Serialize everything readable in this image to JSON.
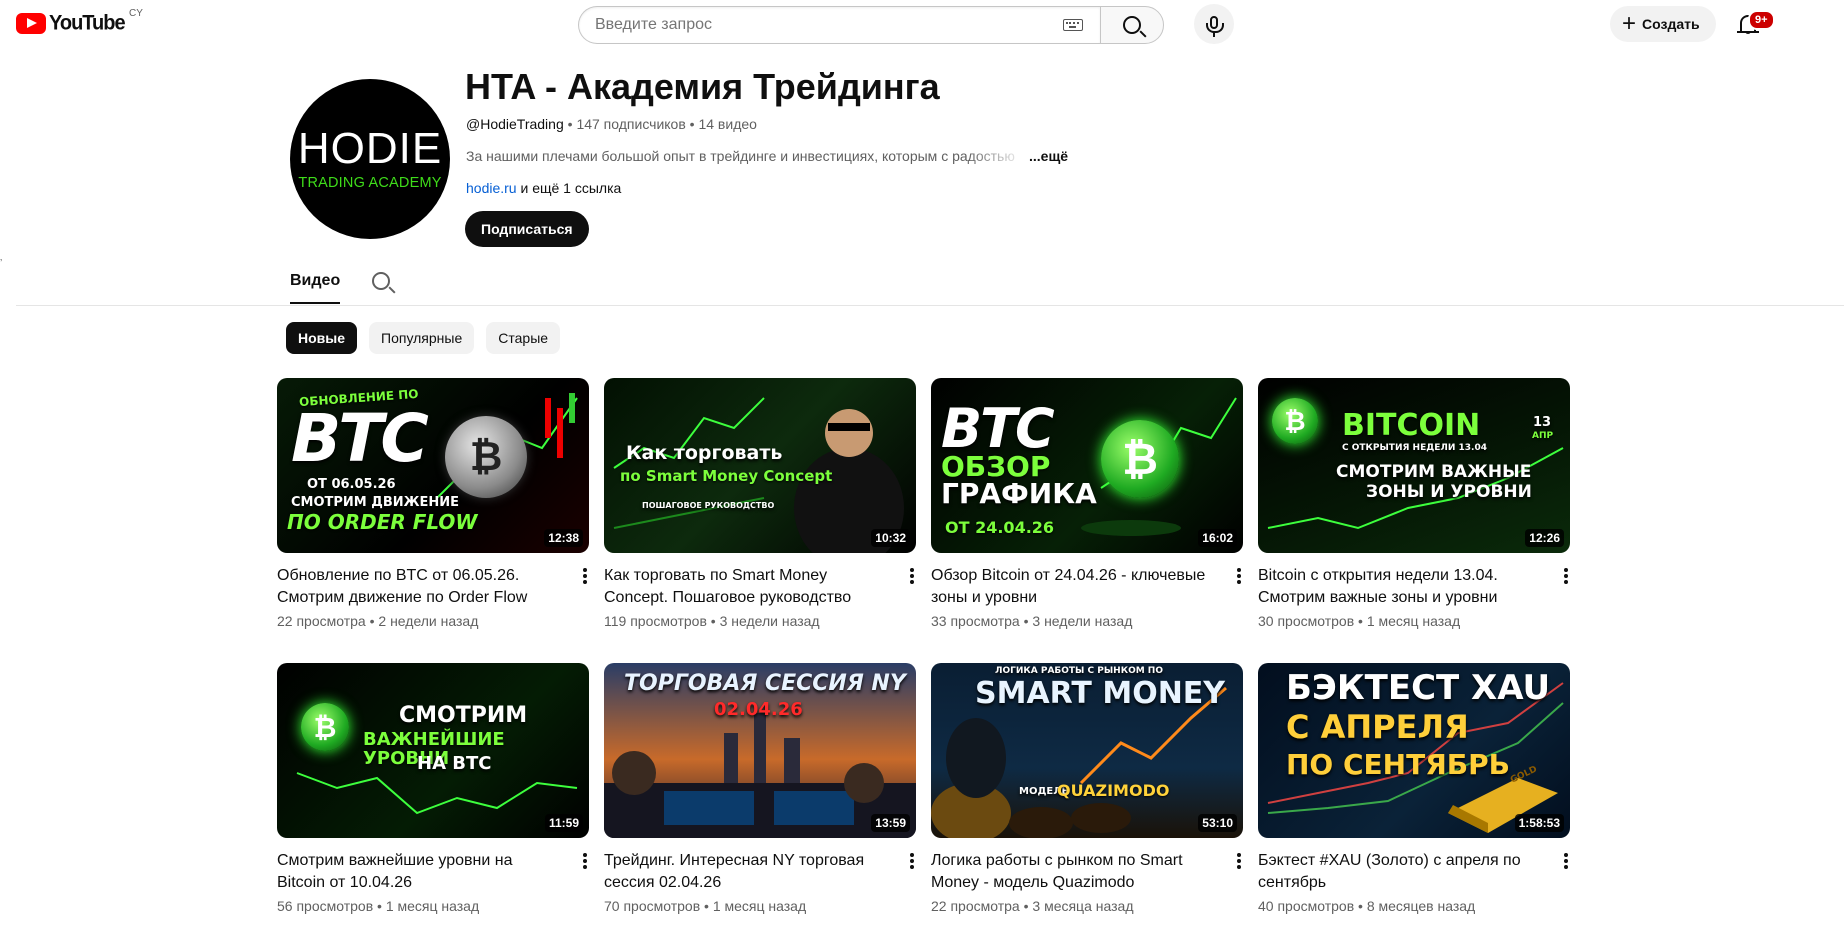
{
  "topbar": {
    "logo_text": "YouTube",
    "logo_country": "CY",
    "search_placeholder": "Введите запрос",
    "create_label": "Создать",
    "notifications_badge": "9+"
  },
  "channel": {
    "avatar_main": "HODIE",
    "avatar_sub": "TRADING ACADEMY",
    "title": "HTA - Академия Трейдинга",
    "handle": "@HodieTrading",
    "subscribers": "147 подписчиков",
    "video_count": "14 видео",
    "description": "За нашими плечами большой опыт в трейдинге и инвестициях, которым с радостью",
    "more_label": "...ещё",
    "link_text": "hodie.ru",
    "link_rest": "и ещё 1 ссылка",
    "subscribe_label": "Подписаться"
  },
  "tabs": {
    "videos_label": "Видео"
  },
  "chips": [
    "Новые",
    "Популярные",
    "Старые"
  ],
  "videos": [
    {
      "title": "Обновление по BTC от 06.05.26. Смотрим движение по Order Flow",
      "views": "22 просмотра",
      "age": "2 недели назад",
      "duration": "12:38",
      "thumb_lines": [
        "ОБНОВЛЕНИЕ ПО",
        "BTC",
        "ОТ 06.05.26",
        "СМОТРИМ ДВИЖЕНИЕ",
        "ПО ORDER FLOW"
      ]
    },
    {
      "title": "Как торговать по Smart Money Concept. Пошаговое руководство",
      "views": "119 просмотров",
      "age": "3 недели назад",
      "duration": "10:32",
      "thumb_lines": [
        "Как торговать",
        "по Smart Money Concept",
        "ПОШАГОВОЕ РУКОВОДСТВО"
      ]
    },
    {
      "title": "Обзор Bitcoin от 24.04.26 - ключевые зоны и уровни",
      "views": "33 просмотра",
      "age": "3 недели назад",
      "duration": "16:02",
      "thumb_lines": [
        "BTC",
        "ОБЗОР",
        "ГРАФИКА",
        "ОТ 24.04.26"
      ]
    },
    {
      "title": "Bitcoin с открытия недели 13.04. Смотрим важные зоны и уровни",
      "views": "30 просмотров",
      "age": "1 месяц назад",
      "duration": "12:26",
      "thumb_lines": [
        "BITCOIN",
        "С ОТКРЫТИЯ НЕДЕЛИ 13.04",
        "СМОТРИМ ВАЖНЫЕ",
        "ЗОНЫ И УРОВНИ",
        "13",
        "АПР"
      ]
    },
    {
      "title": "Смотрим важнейшие уровни на Bitcoin от 10.04.26",
      "views": "56 просмотров",
      "age": "1 месяц назад",
      "duration": "11:59",
      "thumb_lines": [
        "СМОТРИМ",
        "ВАЖНЕЙШИЕ УРОВНИ",
        "НА BTC"
      ]
    },
    {
      "title": "Трейдинг. Интересная NY торговая сессия 02.04.26",
      "views": "70 просмотров",
      "age": "1 месяц назад",
      "duration": "13:59",
      "thumb_lines": [
        "ТОРГОВАЯ СЕССИЯ NY",
        "02.04.26"
      ]
    },
    {
      "title": "Логика работы с рынком по Smart Money - модель Quazimodo",
      "views": "22 просмотра",
      "age": "3 месяца назад",
      "duration": "53:10",
      "thumb_lines": [
        "ЛОГИКА РАБОТЫ С РЫНКОМ ПО",
        "SMART MONEY",
        "МОДЕЛЬ",
        "QUAZIMODO"
      ]
    },
    {
      "title": "Бэктест #XAU (Золото) с апреля по сентябрь",
      "views": "40 просмотров",
      "age": "8 месяцев назад",
      "duration": "1:58:53",
      "thumb_lines": [
        "БЭКТЕСТ XAU",
        "С АПРЕЛЯ",
        "ПО СЕНТЯБРЬ",
        "GOLD"
      ]
    }
  ],
  "colors": {
    "brand_red": "#ff0000",
    "neon_green": "#7cff3c",
    "link_blue": "#065fd4"
  }
}
